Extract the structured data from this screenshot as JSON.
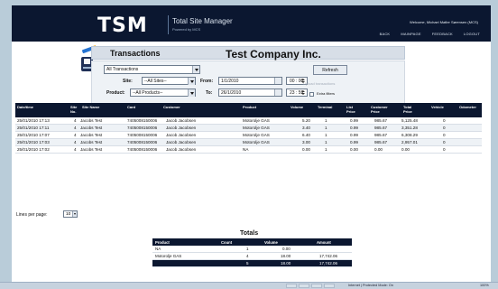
{
  "brand": {
    "logo": "TSM",
    "title": "Total Site Manager",
    "subtitle": "Powered by MCS"
  },
  "welcome": "Welcome, Michael Møller Sørensen (MCS)",
  "nav": [
    "BACK",
    "MAINPAGE",
    "FEEDBACK",
    "LOGOUT"
  ],
  "panel": {
    "title": "Transactions",
    "company": "Test Company Inc.",
    "type_selected": "All Transactions",
    "site_label": "Site:",
    "site_value": "--All Sites--",
    "product_label": "Product:",
    "product_value": "--All Products--",
    "from_label": "From:",
    "from_date": "1/1/2010",
    "from_time": "00 : 00",
    "to_label": "To:",
    "to_date": "26/1/2010",
    "to_time": "23 : 59",
    "refresh": "Refresh",
    "upload": "Upload transactions",
    "extra": "Extra filters"
  },
  "columns": [
    "Date/time",
    "Site No.",
    "Site Name",
    "Card",
    "Customer",
    "Product",
    "Volume",
    "Terminal",
    "List Price",
    "Customer Price",
    "Total Price",
    "Vehicle",
    "Odometer"
  ],
  "rows": [
    [
      "25/01/2010 17:13",
      "4",
      "Jacobs Test",
      "7405008150006",
      "Jacob Jacobsen",
      "Motorolje GAS",
      "5.20",
      "1",
      "0.99",
      "985.67",
      "5,125.48",
      "0",
      ""
    ],
    [
      "25/01/2010 17:11",
      "4",
      "Jacobs Test",
      "7405008150006",
      "Jacob Jacobsen",
      "Motorolje GAS",
      "3.40",
      "1",
      "0.99",
      "985.67",
      "3,351.28",
      "0",
      ""
    ],
    [
      "25/01/2010 17:07",
      "4",
      "Jacobs Test",
      "7405008150006",
      "Jacob Jacobsen",
      "Motorolje GAS",
      "6.40",
      "1",
      "0.99",
      "985.67",
      "6,308.29",
      "0",
      ""
    ],
    [
      "25/01/2010 17:03",
      "4",
      "Jacobs Test",
      "7405008150006",
      "Jacob Jacobsen",
      "Motorolje GAS",
      "3.00",
      "1",
      "0.99",
      "985.67",
      "2,957.01",
      "0",
      ""
    ],
    [
      "25/01/2010 17:02",
      "4",
      "Jacobs Test",
      "7405008150006",
      "Jacob Jacobsen",
      "NA",
      "0.00",
      "1",
      "0.00",
      "0.00",
      "0.00",
      "0",
      ""
    ]
  ],
  "lines_per_page": {
    "label": "Lines per page:",
    "value": "10"
  },
  "totals": {
    "title": "Totals",
    "headers": [
      "Product",
      "Count",
      "Volume",
      "Amount"
    ],
    "rows": [
      [
        "NA",
        "1",
        "0.00",
        ""
      ],
      [
        "Motorolje GAS",
        "4",
        "18.00",
        "17,742.06"
      ],
      [
        "",
        "5",
        "18.00",
        "17,742.06"
      ]
    ]
  },
  "status": {
    "zone": "Internet | Protected Mode: On",
    "zoom": "100%"
  }
}
